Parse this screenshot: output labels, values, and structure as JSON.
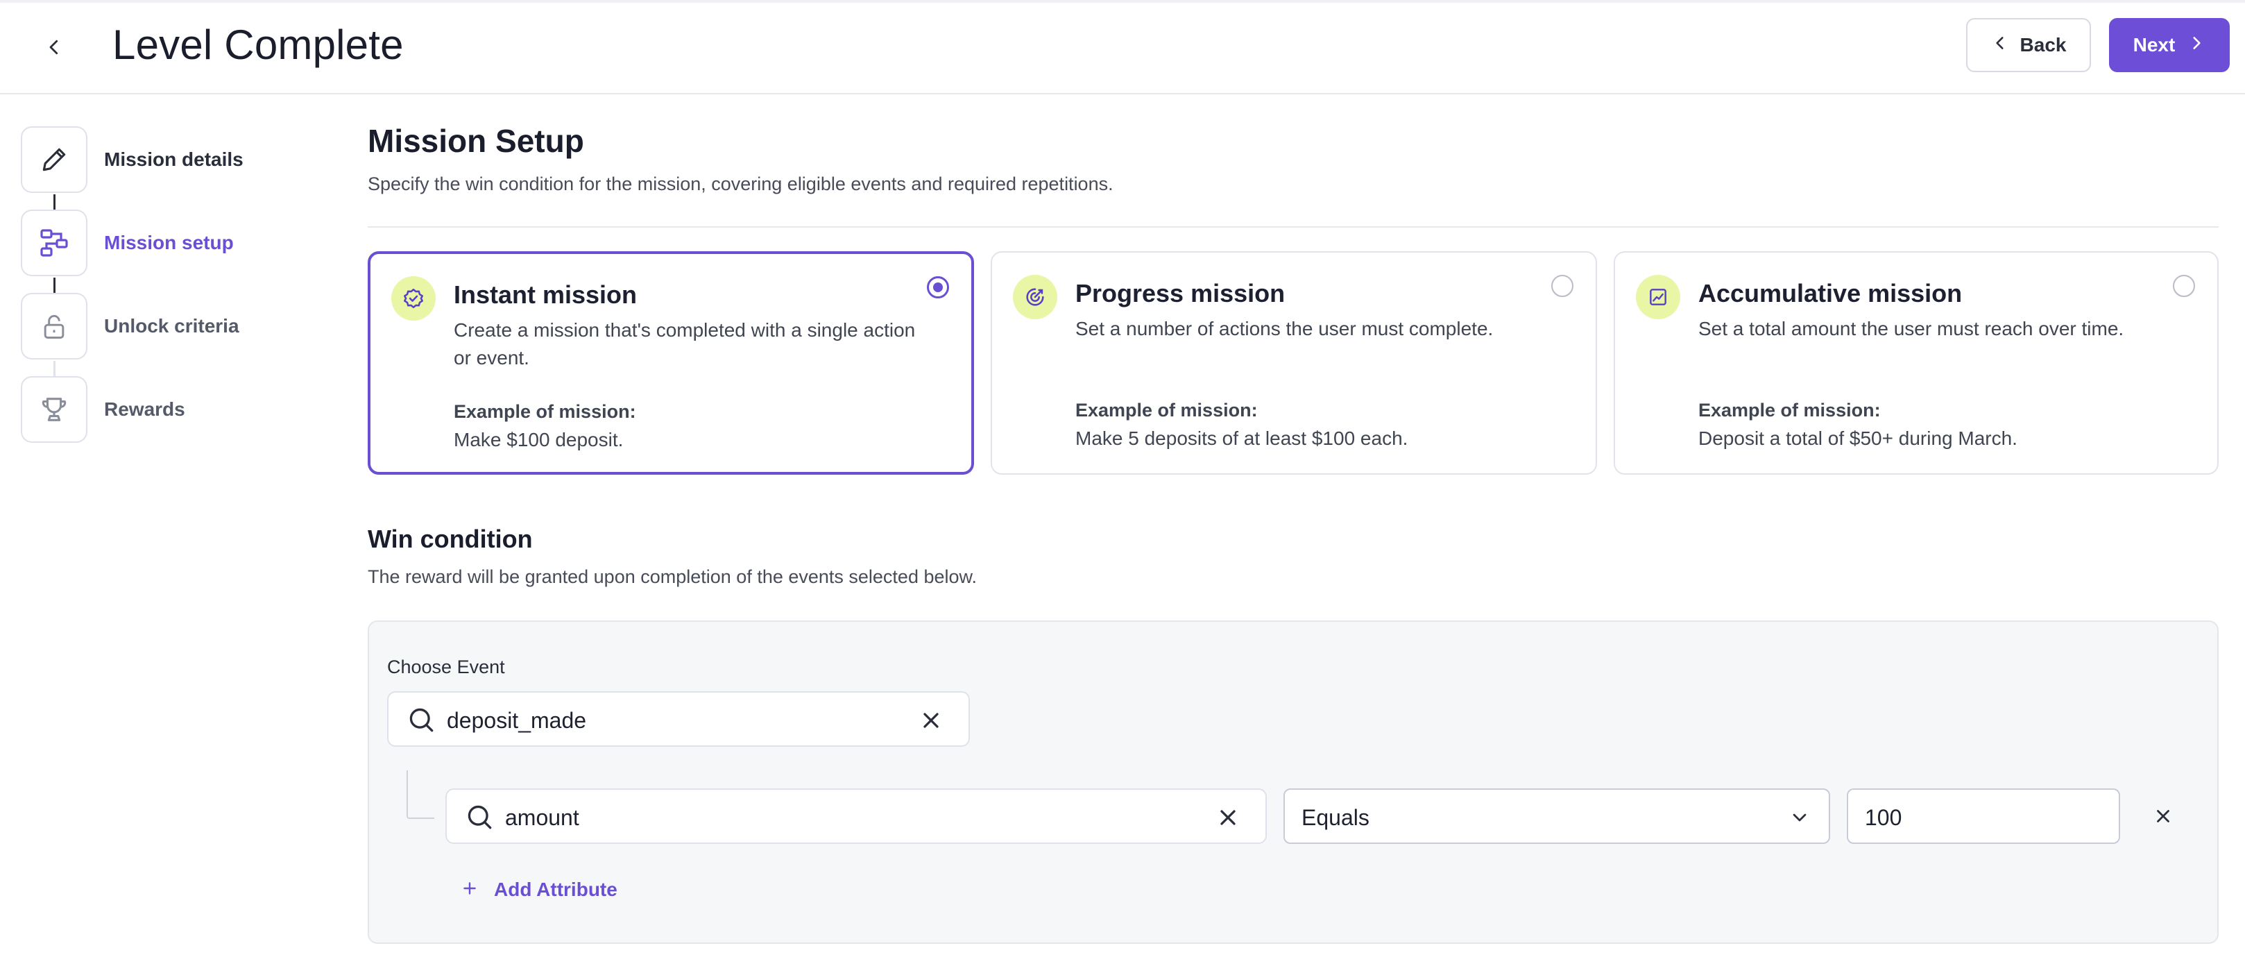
{
  "header": {
    "title": "Level Complete",
    "back_label": "Back",
    "next_label": "Next"
  },
  "steps": [
    {
      "label": "Mission details",
      "icon": "pencil-icon",
      "state": "done"
    },
    {
      "label": "Mission setup",
      "icon": "workflow-icon",
      "state": "active"
    },
    {
      "label": "Unlock criteria",
      "icon": "lock-icon",
      "state": "pending"
    },
    {
      "label": "Rewards",
      "icon": "trophy-icon",
      "state": "pending"
    }
  ],
  "setup": {
    "title": "Mission Setup",
    "subtitle": "Specify the win condition for the mission, covering eligible events and required repetitions."
  },
  "mission_types": [
    {
      "title": "Instant mission",
      "description": "Create a mission that's completed with a single action or event.",
      "example_label": "Example of mission:",
      "example": "Make $100 deposit.",
      "icon": "badge-check-icon",
      "selected": true
    },
    {
      "title": "Progress mission",
      "description": "Set a number of actions the user must complete.",
      "example_label": "Example of mission:",
      "example": "Make 5 deposits of at least $100 each.",
      "icon": "target-icon",
      "selected": false
    },
    {
      "title": "Accumulative mission",
      "description": "Set a total amount the user must reach over time.",
      "example_label": "Example of mission:",
      "example": "Deposit a total of $50+ during March.",
      "icon": "chart-icon",
      "selected": false
    }
  ],
  "win_condition": {
    "title": "Win condition",
    "subtitle": "The reward will be granted upon completion of the events selected below.",
    "choose_event_label": "Choose Event",
    "event_value": "deposit_made",
    "attribute_value": "amount",
    "operator_value": "Equals",
    "compare_value": "100",
    "add_attribute_label": "Add Attribute"
  },
  "colors": {
    "accent": "#6a4fd3",
    "icon_bg": "#e9f6a6",
    "panel_bg": "#f6f7f9"
  }
}
